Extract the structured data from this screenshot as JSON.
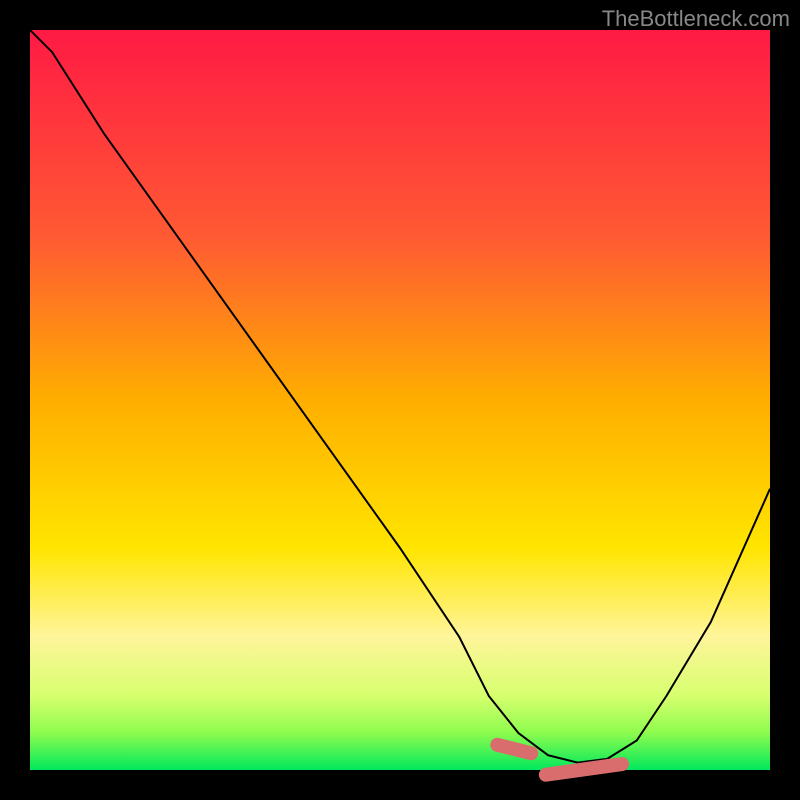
{
  "branding": {
    "watermark": "TheBottleneck.com"
  },
  "gradient": {
    "stops": [
      {
        "offset": 0,
        "color": "#ff1a44"
      },
      {
        "offset": 0.28,
        "color": "#ff5a33"
      },
      {
        "offset": 0.5,
        "color": "#ffae00"
      },
      {
        "offset": 0.7,
        "color": "#ffe500"
      },
      {
        "offset": 0.82,
        "color": "#fff59b"
      },
      {
        "offset": 0.9,
        "color": "#d7ff6e"
      },
      {
        "offset": 0.95,
        "color": "#8dfc4e"
      },
      {
        "offset": 1.0,
        "color": "#00e85c"
      }
    ]
  },
  "chart_data": {
    "type": "line",
    "title": "",
    "xlabel": "",
    "ylabel": "",
    "xlim": [
      0,
      100
    ],
    "ylim": [
      0,
      100
    ],
    "x": [
      0,
      3,
      10,
      20,
      30,
      40,
      50,
      58,
      62,
      66,
      70,
      74,
      78,
      82,
      86,
      92,
      100
    ],
    "values": [
      100,
      97,
      86,
      72,
      58,
      44,
      30,
      18,
      10,
      5,
      2,
      1,
      1.5,
      4,
      10,
      20,
      38
    ],
    "highlight_range_x": [
      62,
      81
    ],
    "highlight_y": 1,
    "description": "V-shaped bottleneck curve on rainbow gradient; minimum near x≈73 with highlighted optimal band"
  }
}
